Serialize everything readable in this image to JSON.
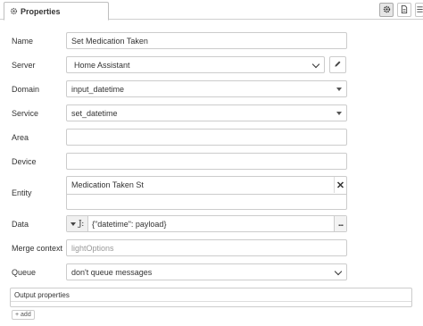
{
  "tab": {
    "label": "Properties",
    "icon": "gear-icon"
  },
  "toolbar": {
    "icons": [
      "gear-icon",
      "document-icon",
      "list-icon"
    ]
  },
  "form": {
    "name": {
      "label": "Name",
      "value": "Set Medication Taken"
    },
    "server": {
      "label": "Server",
      "value": "Home Assistant"
    },
    "domain": {
      "label": "Domain",
      "value": "input_datetime"
    },
    "service": {
      "label": "Service",
      "value": "set_datetime"
    },
    "area": {
      "label": "Area",
      "value": ""
    },
    "device": {
      "label": "Device",
      "value": ""
    },
    "entity": {
      "label": "Entity",
      "value": "Medication Taken St",
      "remove": "✕"
    },
    "data": {
      "label": "Data",
      "type_icon": "J:",
      "value": "{\"datetime\": payload}",
      "more": "..."
    },
    "merge_context": {
      "label": "Merge context",
      "placeholder": "lightOptions"
    },
    "queue": {
      "label": "Queue",
      "value": "don't queue messages"
    }
  },
  "output": {
    "label": "Output properties",
    "add_label": "+ add"
  }
}
